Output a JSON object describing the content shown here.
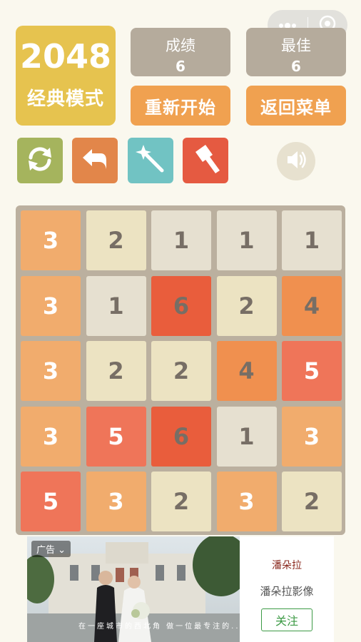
{
  "menu_capsule": {
    "more_icon": "more-dots-icon",
    "close_icon": "target-circle-icon"
  },
  "logo": {
    "title": "2048",
    "subtitle": "经典模式"
  },
  "score": {
    "label": "成绩",
    "value": "6"
  },
  "best": {
    "label": "最佳",
    "value": "6"
  },
  "buttons": {
    "restart": "重新开始",
    "menu": "返回菜单"
  },
  "tools": [
    {
      "icon": "refresh-icon",
      "color": "#a5b45d"
    },
    {
      "icon": "undo-arrow-icon",
      "color": "#e2864a"
    },
    {
      "icon": "magic-wand-icon",
      "color": "#71c3c3"
    },
    {
      "icon": "hammer-icon",
      "color": "#e55a41"
    }
  ],
  "sound_icon": "speaker-icon",
  "board": {
    "rows": [
      [
        3,
        2,
        1,
        1,
        1
      ],
      [
        3,
        1,
        6,
        2,
        4
      ],
      [
        3,
        2,
        2,
        4,
        5
      ],
      [
        3,
        5,
        6,
        1,
        3
      ],
      [
        5,
        3,
        2,
        3,
        2
      ]
    ],
    "tile_colors": {
      "1": {
        "bg": "#e6e0d0",
        "fg": "#776e65"
      },
      "2": {
        "bg": "#ece3c2",
        "fg": "#776e65"
      },
      "3": {
        "bg": "#f1ac6d",
        "fg": "#ffffff"
      },
      "4": {
        "bg": "#f0904f",
        "fg": "#776e65"
      },
      "5": {
        "bg": "#ef7559",
        "fg": "#ffffff"
      },
      "6": {
        "bg": "#e95d3c",
        "fg": "#776e65"
      }
    }
  },
  "ad": {
    "tag": "广告",
    "caption": "在一座城市的西北角 做一位最专注的...",
    "logo_text": "潘朵拉",
    "advertiser": "潘朵拉影像",
    "follow": "关注"
  }
}
